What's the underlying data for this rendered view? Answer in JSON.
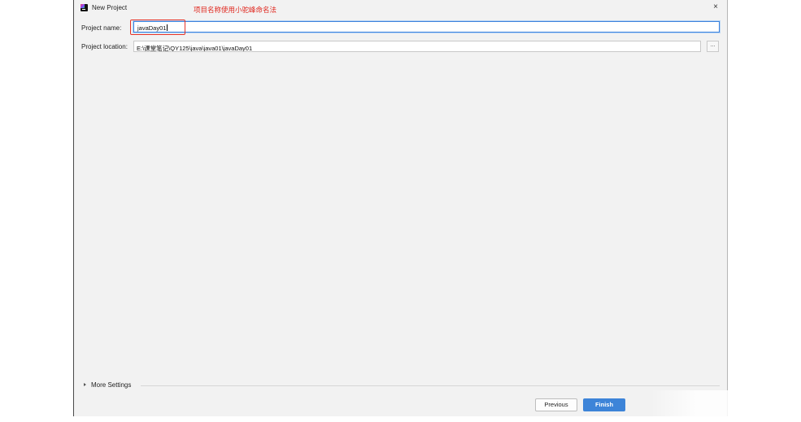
{
  "window": {
    "title": "New Project",
    "close_glyph": "×",
    "app_icon": "intellij-idea-icon"
  },
  "annotation": {
    "text": "项目名称使用小驼峰命名法",
    "color": "#e0261d"
  },
  "form": {
    "project_name_label": "Project name:",
    "project_name_value": "javaDay01",
    "project_location_label": "Project location:",
    "project_location_value": "E:\\课堂笔记\\QY125\\java\\java01\\javaDay01",
    "browse_label": "..."
  },
  "more_settings": {
    "label": "More Settings"
  },
  "buttons": {
    "previous": "Previous",
    "finish": "Finish"
  },
  "colors": {
    "accent": "#3d84d8",
    "dialog_background": "#f2f2f2",
    "highlight": "#e53329"
  }
}
